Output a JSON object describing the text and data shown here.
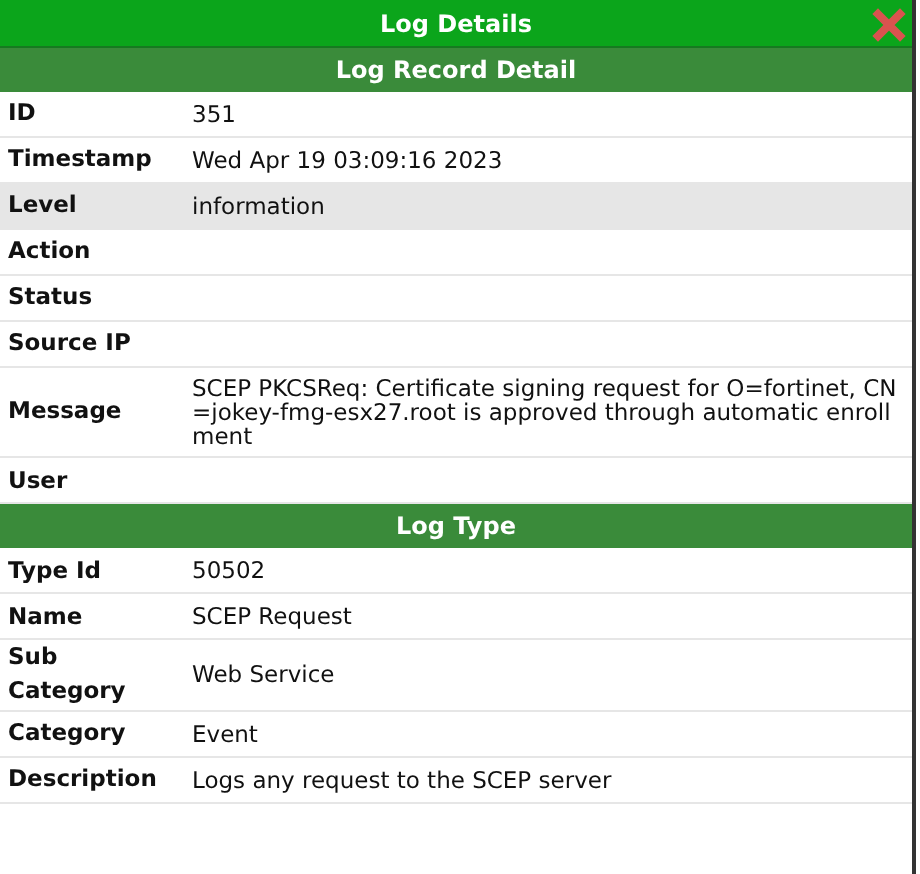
{
  "window": {
    "title": "Log Details"
  },
  "sections": [
    {
      "title": "Log Record Detail",
      "rows": [
        {
          "label": "ID",
          "value": "351",
          "selected": false
        },
        {
          "label": "Timestamp",
          "value": "Wed Apr 19 03:09:16 2023",
          "selected": false
        },
        {
          "label": "Level",
          "value": "information",
          "selected": true
        },
        {
          "label": "Action",
          "selected": false
        },
        {
          "label": "Status",
          "selected": false
        },
        {
          "label": "Source IP",
          "selected": false
        },
        {
          "label": "Message",
          "value": "SCEP PKCSReq: Certificate signing request for O=fortinet, CN=jokey-fmg-esx27.root is approved through automatic enrollment",
          "selected": false
        },
        {
          "label": "User",
          "selected": false
        }
      ]
    },
    {
      "title": "Log Type",
      "rows": [
        {
          "label": "Type Id",
          "value": "50502",
          "selected": false
        },
        {
          "label": "Name",
          "value": "SCEP Request",
          "selected": false
        },
        {
          "label": "Sub Category",
          "value": "Web Service",
          "selected": false
        },
        {
          "label": "Category",
          "value": "Event",
          "selected": false
        },
        {
          "label": "Description",
          "value": "Logs any request to the SCEP server",
          "selected": false
        }
      ]
    }
  ]
}
